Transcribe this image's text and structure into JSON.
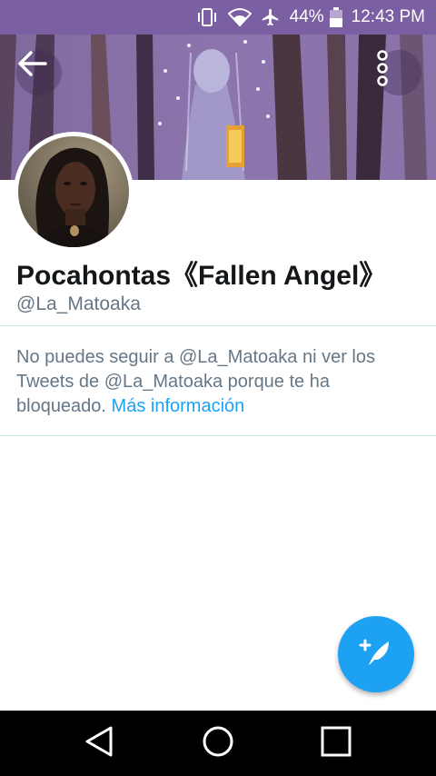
{
  "status_bar": {
    "battery": "44%",
    "time": "12:43 PM",
    "icons": [
      "vibrate-icon",
      "wifi-icon",
      "airplane-icon",
      "battery-icon"
    ]
  },
  "header": {
    "back_icon": "arrow-left-icon",
    "more_icon": "vertical-dots-icon"
  },
  "profile": {
    "display_name": "Pocahontas《Fallen Angel》",
    "handle": "@La_Matoaka"
  },
  "blocked_notice": {
    "message": "No puedes seguir a @La_Matoaka ni ver los Tweets de @La_Matoaka porque te ha bloqueado.",
    "link": "Más información"
  },
  "fab": {
    "icon": "compose-tweet-icon"
  },
  "nav_bar": {
    "icons": [
      "nav-back-icon",
      "nav-home-icon",
      "nav-recents-icon"
    ]
  },
  "colors": {
    "status_bar": "#7a5fa3",
    "accent": "#1da1f2",
    "secondary_text": "#657786",
    "primary_text": "#14171a"
  }
}
